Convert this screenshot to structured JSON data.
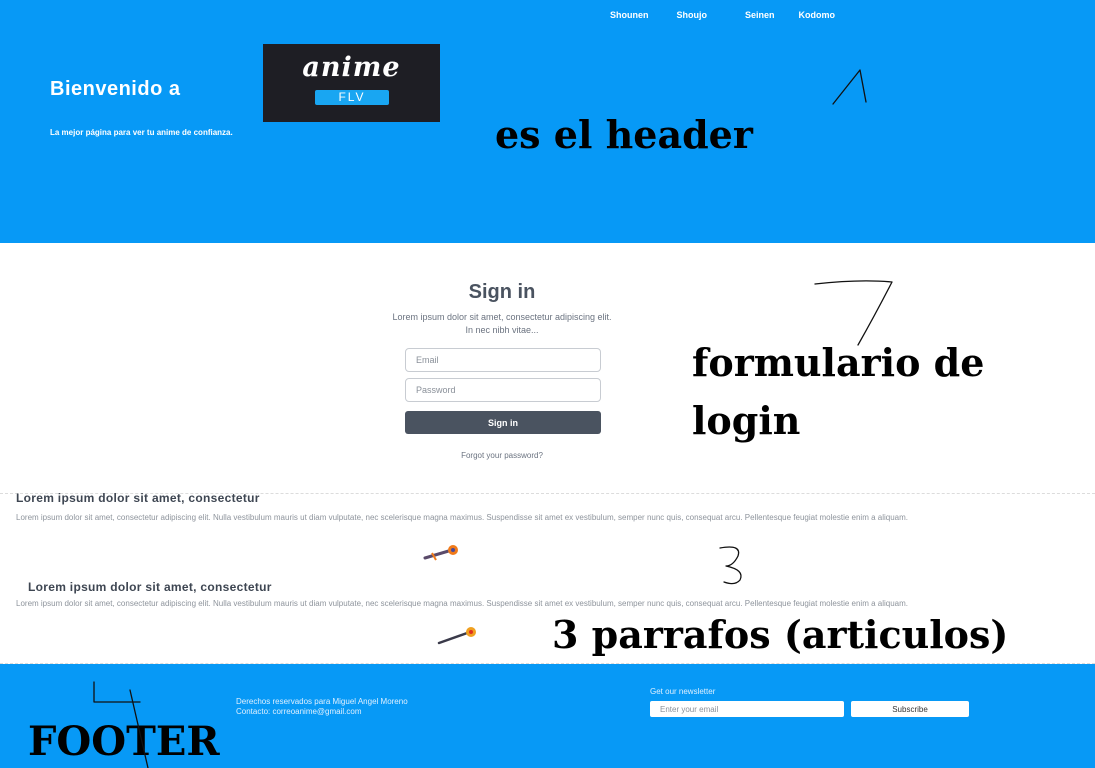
{
  "header": {
    "nav": [
      "Shounen",
      "Shoujo",
      "Seinen",
      "Kodomo"
    ],
    "welcome": "Bienvenido a",
    "logo": {
      "word": "anime",
      "badge": "FLV"
    },
    "tagline": "La mejor página para ver tu anime de confianza."
  },
  "annotations": {
    "header": "es el header",
    "form_line1": "formulario de",
    "form_line2": "login",
    "articles": "3 parrafos (articulos)",
    "footer": "FOOTER",
    "marks": [
      "1",
      "2",
      "3",
      "4"
    ]
  },
  "login": {
    "title": "Sign in",
    "description": "Lorem ipsum dolor sit amet, consectetur adipiscing elit. In nec nibh vitae...",
    "email_placeholder": "Email",
    "password_placeholder": "Password",
    "submit_label": "Sign in",
    "forgot_label": "Forgot your password?"
  },
  "articles": [
    {
      "title": "Lorem ipsum dolor sit amet, consectetur",
      "body": "Lorem ipsum dolor sit amet, consectetur adipiscing elit. Nulla vestibulum mauris ut diam vulputate, nec scelerisque magna maximus. Suspendisse sit amet ex vestibulum, semper nunc quis, consequat arcu. Pellentesque feugiat molestie enim a aliquam."
    },
    {
      "title": "Lorem ipsum dolor sit amet, consectetur",
      "body": "Lorem ipsum dolor sit amet, consectetur adipiscing elit. Nulla vestibulum mauris ut diam vulputate, nec scelerisque magna maximus. Suspendisse sit amet ex vestibulum, semper nunc quis, consequat arcu. Pellentesque feugiat molestie enim a aliquam."
    }
  ],
  "footer": {
    "rights_line1": "Derechos reservados para Miguel Angel Moreno",
    "rights_line2": "Contacto:  correoanime@gmail.com",
    "newsletter_label": "Get our newsletter",
    "email_placeholder": "Enter your email",
    "subscribe_label": "Subscribe"
  },
  "colors": {
    "header_bg": "#0799f6",
    "footer_bg": "#0799f6",
    "button_dark": "#4a5360",
    "logo_bg": "#1e1e24",
    "logo_badge": "#19a6f2"
  }
}
